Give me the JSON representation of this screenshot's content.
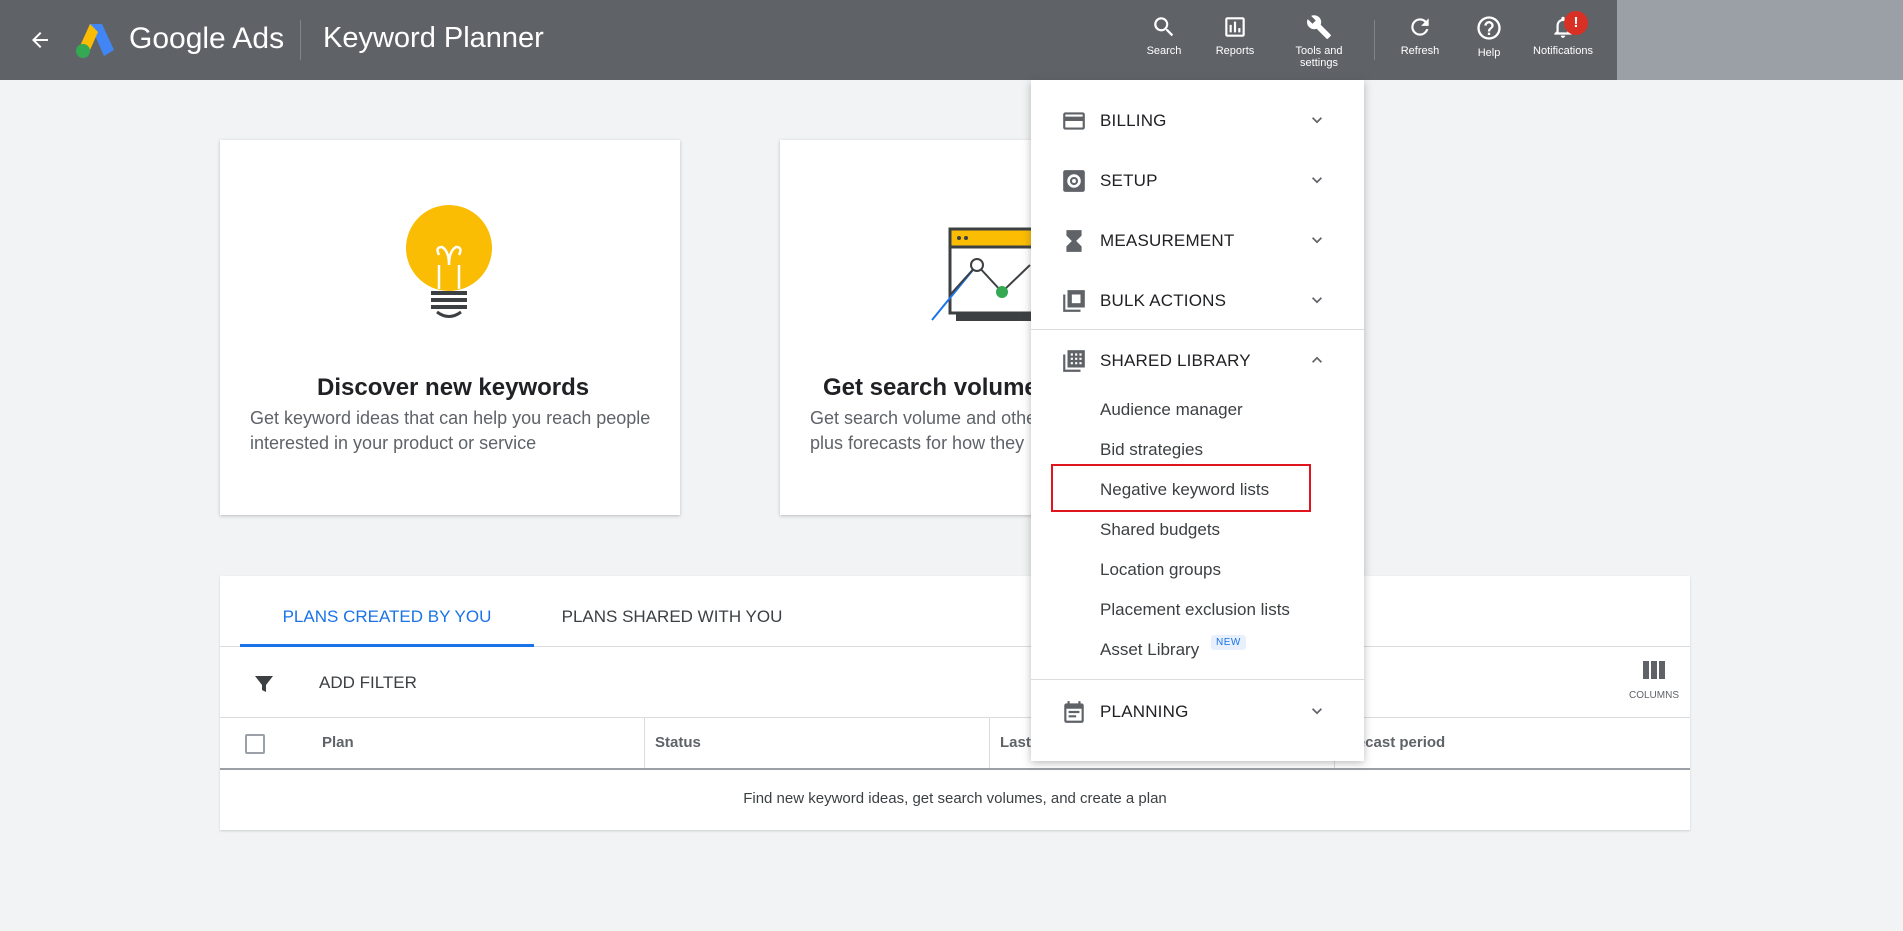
{
  "header": {
    "brand": "Google Ads",
    "product": "Keyword Planner",
    "buttons": [
      {
        "label": "Search",
        "icon": "search-icon"
      },
      {
        "label": "Reports",
        "icon": "reports-icon"
      },
      {
        "label": "Tools and settings",
        "icon": "wrench-icon"
      },
      {
        "label": "Refresh",
        "icon": "refresh-icon"
      },
      {
        "label": "Help",
        "icon": "help-icon"
      },
      {
        "label": "Notifications",
        "icon": "bell-icon"
      }
    ],
    "notification_badge": "!"
  },
  "cards": [
    {
      "title": "Discover new keywords",
      "desc_line1": "Get keyword ideas that can help you reach people",
      "desc_line2": "interested in your product or service"
    },
    {
      "title": "Get search volume",
      "desc_line1": "Get search volume and othe",
      "desc_line2": "plus forecasts for how they"
    }
  ],
  "table": {
    "tabs": [
      "PLANS CREATED BY YOU",
      "PLANS SHARED WITH YOU"
    ],
    "add_filter": "ADD FILTER",
    "columns_label": "COLUMNS",
    "headers": [
      "Plan",
      "Status",
      "Last",
      "recast period"
    ],
    "empty_message": "Find new keyword ideas, get search volumes, and create a plan"
  },
  "menu": {
    "sections": [
      {
        "label": "BILLING",
        "icon": "credit-card-icon"
      },
      {
        "label": "SETUP",
        "icon": "gear-icon"
      },
      {
        "label": "MEASUREMENT",
        "icon": "hourglass-icon"
      },
      {
        "label": "BULK ACTIONS",
        "icon": "copy-icon"
      },
      {
        "label": "SHARED LIBRARY",
        "icon": "library-icon"
      },
      {
        "label": "PLANNING",
        "icon": "calendar-icon"
      }
    ],
    "shared_library_items": [
      "Audience manager",
      "Bid strategies",
      "Negative keyword lists",
      "Shared budgets",
      "Location groups",
      "Placement exclusion lists",
      "Asset Library"
    ],
    "new_badge": "NEW"
  },
  "colors": {
    "topbar": "#5f6368",
    "accent": "#1a73e8",
    "highlight": "#e0161f",
    "bulb": "#fbbc04"
  }
}
